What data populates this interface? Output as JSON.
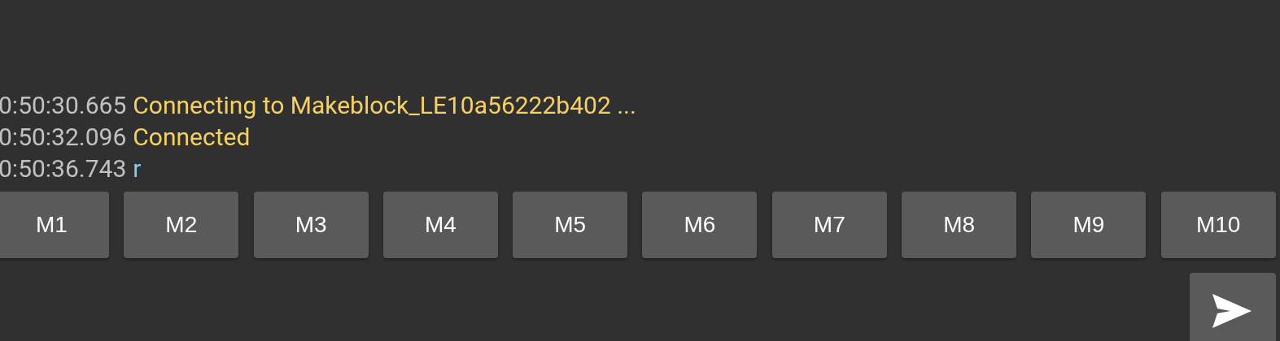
{
  "log": [
    {
      "time": "0:50:30.665",
      "message": "Connecting to Makeblock_LE10a56222b402 ...",
      "color": "#f5d165"
    },
    {
      "time": "0:50:32.096",
      "message": "Connected",
      "color": "#f5d165"
    },
    {
      "time": "0:50:36.743",
      "message": "r",
      "color": "#8cc8f0"
    }
  ],
  "macro_buttons": [
    "M1",
    "M2",
    "M3",
    "M4",
    "M5",
    "M6",
    "M7",
    "M8",
    "M9",
    "M10"
  ]
}
